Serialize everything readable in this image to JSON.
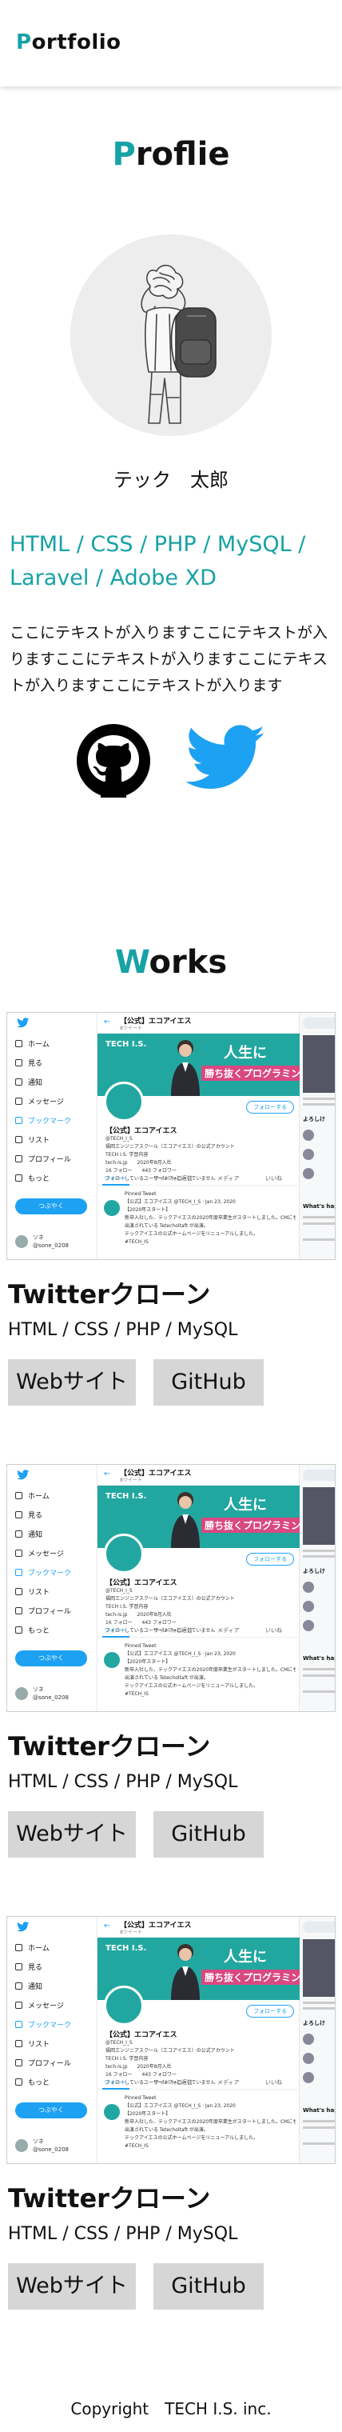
{
  "header": {
    "logo_first": "P",
    "logo_rest": "ortfolio"
  },
  "profile": {
    "title_first": "P",
    "title_rest": "roflie",
    "name": "テック　太郎",
    "skills": "HTML / CSS / PHP / MySQL / Laravel / Adobe XD",
    "bio": "ここにテキストが入りますここにテキストが入りますここにテキストが入りますここにテキストが入りますここにテキストが入ります",
    "social_icons": [
      "github-icon",
      "twitter-icon"
    ]
  },
  "works": {
    "title_first": "W",
    "title_rest": "orks",
    "items": [
      {
        "title": "Twitterクローン",
        "tech": "HTML / CSS / PHP / MySQL",
        "site_label": "Webサイト",
        "github_label": "GitHub"
      },
      {
        "title": "Twitterクローン",
        "tech": "HTML / CSS / PHP / MySQL",
        "site_label": "Webサイト",
        "github_label": "GitHub"
      },
      {
        "title": "Twitterクローン",
        "tech": "HTML / CSS / PHP / MySQL",
        "site_label": "Webサイト",
        "github_label": "GitHub"
      }
    ],
    "screenshot": {
      "menu": [
        "ホーム",
        "見る",
        "通知",
        "メッセージ",
        "ブックマーク",
        "リスト",
        "プロフィール",
        "もっと"
      ],
      "menu_active_index": 4,
      "tweet_button": "つぶやく",
      "user_name": "ソネ",
      "user_handle": "@sone_0208",
      "account_name": "【公式】エコアイエス",
      "account_sub": "8ツイート",
      "banner_logo": "TECH I.S.",
      "banner_line1": "人生に",
      "banner_line2": "勝ち抜くプログラミング",
      "follow_label": "フォローする",
      "profile_name": "【公式】エコアイエス",
      "profile_lines": [
        "@TECH_I_S",
        "福岡エンジニアスクール（エコアイエス）の公式アカウント",
        "TECH I.S. 学習内容",
        "tech-is.jp　　2020年8月入社",
        "16 フォロー　　443 フォロワー",
        "フォローしているユーザーはフォローしていません"
      ],
      "tabs": [
        "ツイート",
        "ツイートと返信",
        "メディア",
        "いいね"
      ],
      "tweet_lines": [
        "Pinned Tweet",
        "【公式】エコアイエス @TECH_I_S · Jan 23, 2020",
        "【2020年スタート】",
        "新卒入社した、テックアイエスの2020年度卒業生がスタートしました。CMにも",
        "出演されている Tetecholtaft が出演。",
        "テックアイエスの公式ホームページをリニューアルしました。",
        "#TECH_IS"
      ],
      "right_title": "What's happening",
      "right_sub": "よろしけ"
    }
  },
  "footer": {
    "copyright": "Copyright　TECH I.S. inc."
  }
}
